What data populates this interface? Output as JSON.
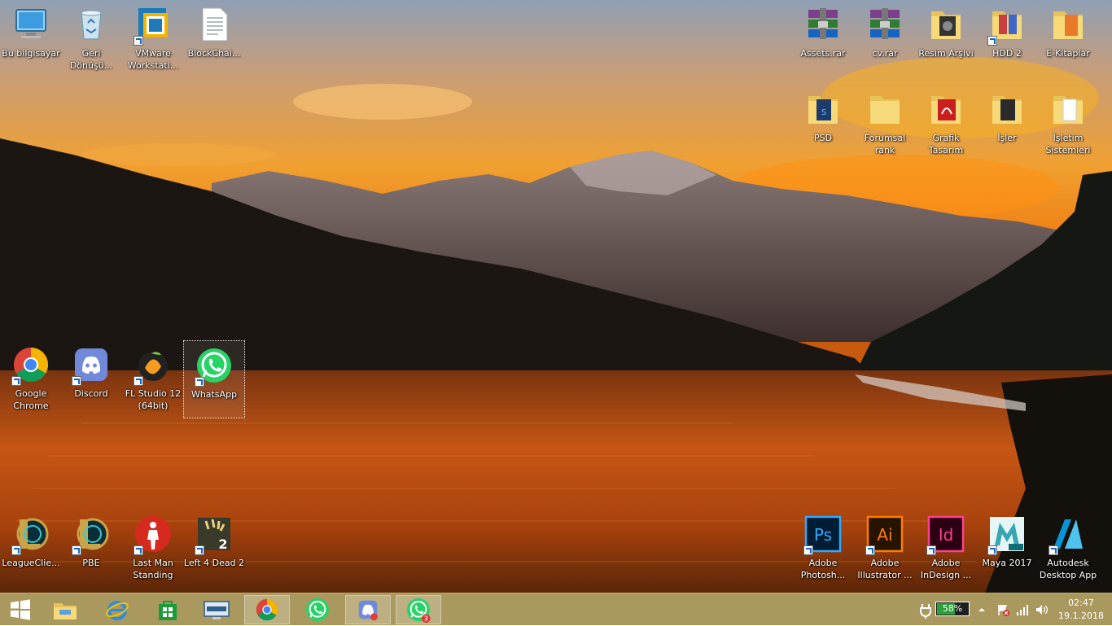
{
  "desktop": {
    "icons": [
      {
        "name": "this-pc-icon",
        "label": [
          "Bu bilgisayar"
        ],
        "kind": "pc"
      },
      {
        "name": "recycle-bin-icon",
        "label": [
          "Geri",
          "Dönüşü..."
        ],
        "kind": "bin"
      },
      {
        "name": "vmware-icon",
        "label": [
          "VMware",
          "Workstati..."
        ],
        "kind": "vmware",
        "shortcut": true
      },
      {
        "name": "text-file-icon",
        "label": [
          "BlockChai..."
        ],
        "kind": "txt"
      },
      {
        "name": "rar-archive-icon",
        "label": [
          "Assets.rar"
        ],
        "kind": "rar"
      },
      {
        "name": "rar-archive-icon",
        "label": [
          "cv.rar"
        ],
        "kind": "rar"
      },
      {
        "name": "folder-icon",
        "label": [
          "Resim Arşivi"
        ],
        "kind": "folder-photo"
      },
      {
        "name": "folder-icon",
        "label": [
          "HDD 2"
        ],
        "kind": "folder-doc",
        "shortcut": true
      },
      {
        "name": "folder-icon",
        "label": [
          "E-Kitaplar"
        ],
        "kind": "folder-doc2"
      },
      {
        "name": "folder-icon",
        "label": [
          "PSD"
        ],
        "kind": "folder-psd"
      },
      {
        "name": "folder-icon",
        "label": [
          "Forumsal",
          "rank"
        ],
        "kind": "folder"
      },
      {
        "name": "folder-icon",
        "label": [
          "Grafik",
          "Tasarım"
        ],
        "kind": "folder-red"
      },
      {
        "name": "folder-icon",
        "label": [
          "İşler"
        ],
        "kind": "folder-dark"
      },
      {
        "name": "folder-icon",
        "label": [
          "İşletim",
          "Sistemleri"
        ],
        "kind": "folder-white"
      },
      {
        "name": "chrome-icon",
        "label": [
          "Google",
          "Chrome"
        ],
        "kind": "chrome",
        "shortcut": true
      },
      {
        "name": "discord-icon",
        "label": [
          "Discord"
        ],
        "kind": "discord",
        "shortcut": true
      },
      {
        "name": "fl-studio-icon",
        "label": [
          "FL Studio 12",
          "(64bit)"
        ],
        "kind": "fl",
        "shortcut": true
      },
      {
        "name": "whatsapp-icon",
        "label": [
          "WhatsApp"
        ],
        "kind": "whatsapp",
        "shortcut": true,
        "selected": true
      },
      {
        "name": "league-client-icon",
        "label": [
          "LeagueClie..."
        ],
        "kind": "lol",
        "shortcut": true
      },
      {
        "name": "league-pbe-icon",
        "label": [
          "PBE"
        ],
        "kind": "lol",
        "shortcut": true
      },
      {
        "name": "last-man-standing-icon",
        "label": [
          "Last Man",
          "Standing"
        ],
        "kind": "lms",
        "shortcut": true
      },
      {
        "name": "left4dead2-icon",
        "label": [
          "Left 4 Dead 2"
        ],
        "kind": "l4d",
        "shortcut": true
      },
      {
        "name": "photoshop-icon",
        "label": [
          "Adobe",
          "Photosh..."
        ],
        "kind": "ps",
        "shortcut": true
      },
      {
        "name": "illustrator-icon",
        "label": [
          "Adobe",
          "Illustrator ..."
        ],
        "kind": "ai",
        "shortcut": true
      },
      {
        "name": "indesign-icon",
        "label": [
          "Adobe",
          "InDesign ..."
        ],
        "kind": "id",
        "shortcut": true
      },
      {
        "name": "maya-icon",
        "label": [
          "Maya 2017"
        ],
        "kind": "maya",
        "shortcut": true
      },
      {
        "name": "autodesk-app-icon",
        "label": [
          "Autodesk",
          "Desktop App"
        ],
        "kind": "autodesk",
        "shortcut": true
      }
    ]
  },
  "taskbar": {
    "buttons": [
      {
        "name": "start-button",
        "kind": "start"
      },
      {
        "name": "file-explorer-button",
        "kind": "explorer"
      },
      {
        "name": "internet-explorer-button",
        "kind": "ie"
      },
      {
        "name": "store-button",
        "kind": "store"
      },
      {
        "name": "lenovo-button",
        "kind": "lenovo"
      },
      {
        "name": "chrome-taskbar-button",
        "kind": "chrome",
        "active": true
      },
      {
        "name": "whatsapp-taskbar-button",
        "kind": "whatsapp"
      },
      {
        "name": "discord-taskbar-button",
        "kind": "discord-tb",
        "active": true
      },
      {
        "name": "whatsapp-taskbar-button-2",
        "kind": "whatsapp",
        "badge": "3",
        "active": true
      }
    ],
    "battery_percent": "58%",
    "battery_level": 0.58,
    "clock_time": "02:47",
    "clock_date": "19.1.2018"
  }
}
